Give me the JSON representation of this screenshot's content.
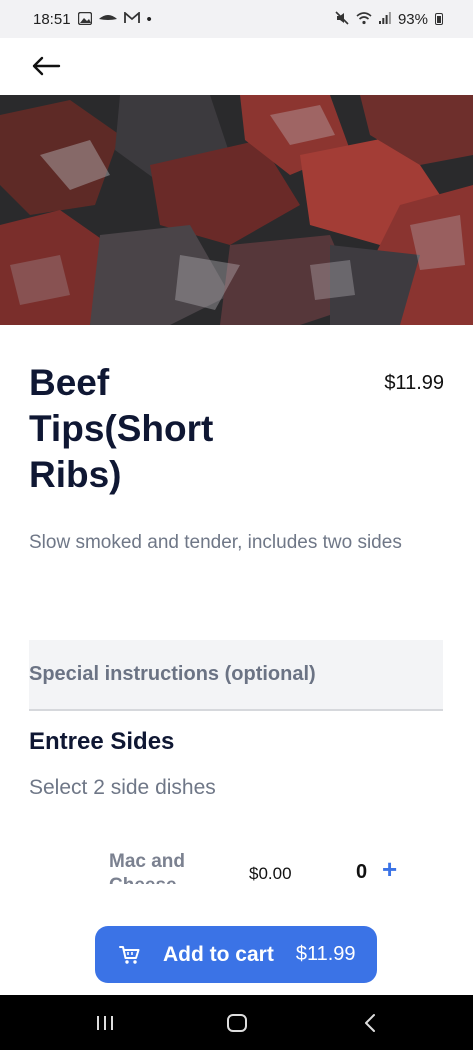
{
  "status_bar": {
    "time": "18:51",
    "battery": "93%",
    "dot": "•"
  },
  "app_bar": {
    "back_icon": "arrow-left-icon"
  },
  "item": {
    "title": "Beef Tips(Short Ribs)",
    "price": "$11.99",
    "description": "Slow smoked and tender, includes two sides"
  },
  "special_instructions": {
    "placeholder": "Special instructions (optional)"
  },
  "sides": {
    "title": "Entree Sides",
    "subtitle": "Select 2 side dishes",
    "items": [
      {
        "name": "Mac and Cheese",
        "price": "$0.00",
        "qty": "0",
        "add": "+"
      }
    ]
  },
  "cart_button": {
    "label": "Add to cart",
    "total": "$11.99"
  },
  "colors": {
    "accent": "#3b73e6",
    "title": "#0f1733",
    "muted": "#6f7787"
  }
}
